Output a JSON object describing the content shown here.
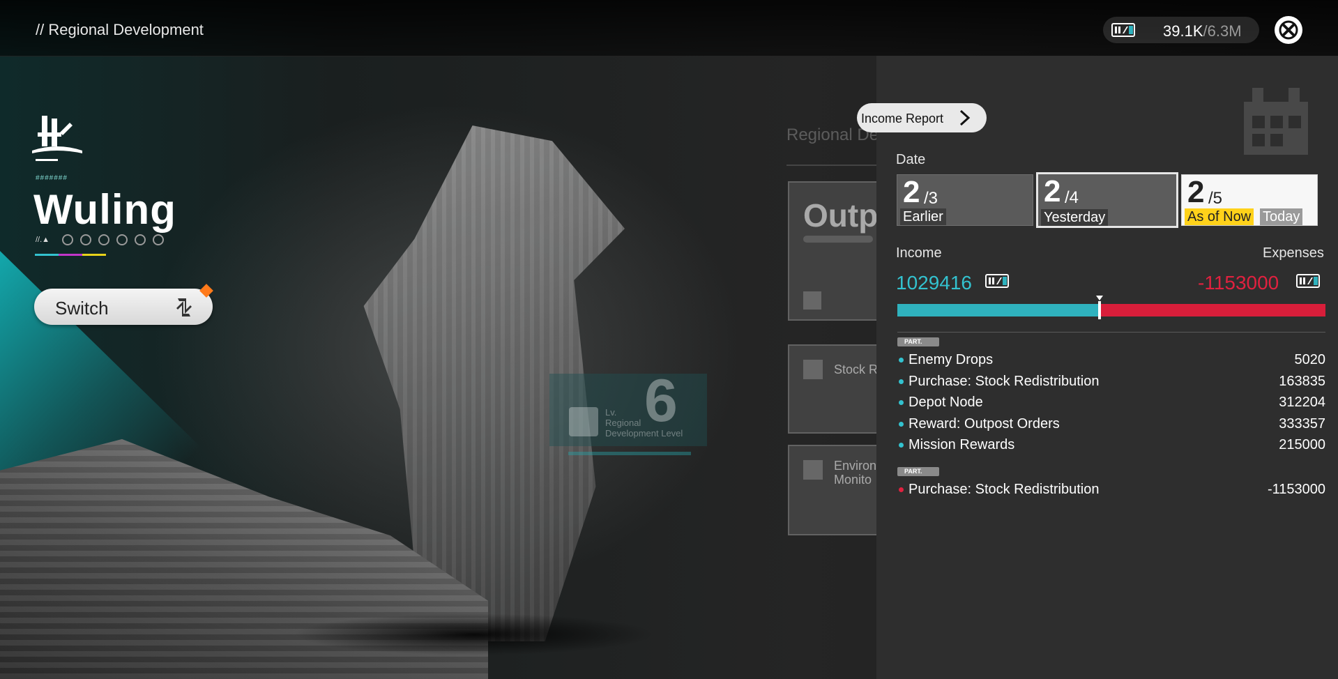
{
  "header": {
    "title": "// Regional Development",
    "currency": {
      "current": "39.1K",
      "cap": "/6.3M",
      "icon": "stock-bill-icon"
    },
    "close_icon": "close-icon"
  },
  "region": {
    "name": "Wuling",
    "code": "#######",
    "tag": "//.▲",
    "switch_label": "Switch"
  },
  "background": {
    "section_title": "Regional De",
    "card_outpost": "Outp",
    "card_stock": "Stock R",
    "card_env_line1": "Environ",
    "card_env_line2": "Monito",
    "level": {
      "value": "6",
      "lv": "Lv.",
      "line1": "Regional",
      "line2": "Development Level"
    }
  },
  "panel": {
    "income_report_label": "Income Report",
    "date_label": "Date",
    "dates": [
      {
        "day": "2",
        "month": "/3",
        "label": "Earlier"
      },
      {
        "day": "2",
        "month": "/4",
        "label": "Yesterday"
      },
      {
        "day": "2",
        "month": "/5",
        "label": "As of Now",
        "label2": "Today"
      }
    ],
    "income_label": "Income",
    "expenses_label": "Expenses",
    "income_value": "1029416",
    "expenses_value": "-1153000",
    "income_share": 0.4717,
    "part_tag": "PART.",
    "income_items": [
      {
        "name": "Enemy Drops",
        "value": "5020"
      },
      {
        "name": "Purchase: Stock Redistribution",
        "value": "163835"
      },
      {
        "name": "Depot Node",
        "value": "312204"
      },
      {
        "name": "Reward: Outpost Orders",
        "value": "333357"
      },
      {
        "name": "Mission Rewards",
        "value": "215000"
      }
    ],
    "expense_items": [
      {
        "name": "Purchase: Stock Redistribution",
        "value": "-1153000"
      }
    ]
  },
  "colors": {
    "income": "#33c2cf",
    "expenses": "#e0213f",
    "accent_yellow": "#ffd21a",
    "badge_orange": "#ff7a1a"
  }
}
